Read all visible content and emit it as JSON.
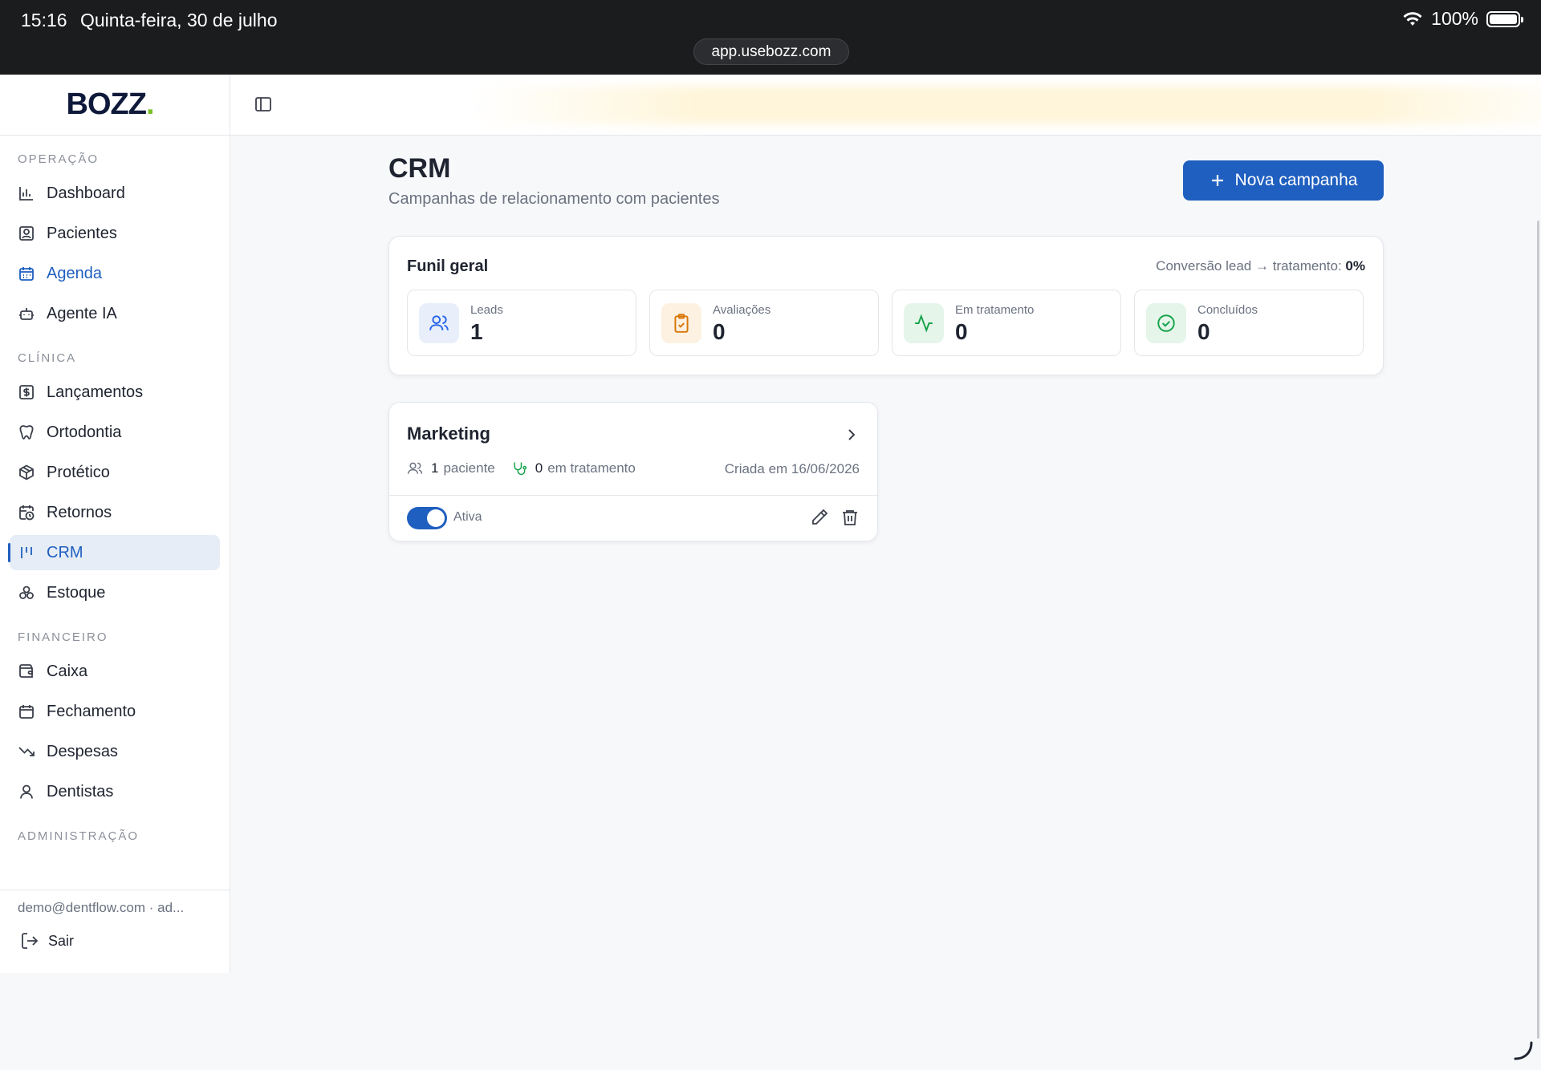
{
  "status_bar": {
    "time": "15:16",
    "date": "Quinta-feira, 30 de julho",
    "battery": "100%",
    "url": "app.usebozz.com"
  },
  "brand": {
    "logo_text": "BOZZ",
    "logo_dot": "."
  },
  "sidebar": {
    "sections": {
      "operacao": "OPERAÇÃO",
      "clinica": "CLÍNICA",
      "financeiro": "FINANCEIRO",
      "administracao": "ADMINISTRAÇÃO"
    },
    "operacao_items": [
      {
        "label": "Dashboard",
        "icon": "bar-chart-icon"
      },
      {
        "label": "Pacientes",
        "icon": "contact-icon"
      },
      {
        "label": "Agenda",
        "icon": "calendar-icon"
      },
      {
        "label": "Agente IA",
        "icon": "bot-icon"
      }
    ],
    "clinica_items": [
      {
        "label": "Lançamentos",
        "icon": "dollar-icon"
      },
      {
        "label": "Ortodontia",
        "icon": "tooth-icon"
      },
      {
        "label": "Protético",
        "icon": "box-icon"
      },
      {
        "label": "Retornos",
        "icon": "calendar-clock-icon"
      },
      {
        "label": "CRM",
        "icon": "kanban-icon"
      },
      {
        "label": "Estoque",
        "icon": "boxes-icon"
      }
    ],
    "financeiro_items": [
      {
        "label": "Caixa",
        "icon": "wallet-icon"
      },
      {
        "label": "Fechamento",
        "icon": "calendar-icon"
      },
      {
        "label": "Despesas",
        "icon": "trending-down-icon"
      },
      {
        "label": "Dentistas",
        "icon": "user-icon"
      }
    ],
    "user": "demo@dentflow.com · ad...",
    "logout": "Sair"
  },
  "page": {
    "title": "CRM",
    "subtitle": "Campanhas de relacionamento com pacientes",
    "new_button": "Nova campanha"
  },
  "funnel": {
    "title": "Funil geral",
    "conversion_label": "Conversão lead → tratamento:",
    "conversion_value": "0%",
    "stats": [
      {
        "label": "Leads",
        "value": "1",
        "color": "#2563eb",
        "bg": "#e8effb"
      },
      {
        "label": "Avaliações",
        "value": "0",
        "color": "#d97706",
        "bg": "#fdf1e2"
      },
      {
        "label": "Em tratamento",
        "value": "0",
        "color": "#16a34a",
        "bg": "#e5f5ea"
      },
      {
        "label": "Concluídos",
        "value": "0",
        "color": "#16a34a",
        "bg": "#e5f5ea"
      }
    ]
  },
  "campaign": {
    "name": "Marketing",
    "patients_count": "1",
    "patients_label": "paciente",
    "treatment_count": "0",
    "treatment_label": "em tratamento",
    "created": "Criada em 16/06/2026",
    "status_label": "Ativa",
    "active": true
  },
  "colors": {
    "primary": "#1f5fbf",
    "sidebar_active_bg": "#e6edf6"
  }
}
